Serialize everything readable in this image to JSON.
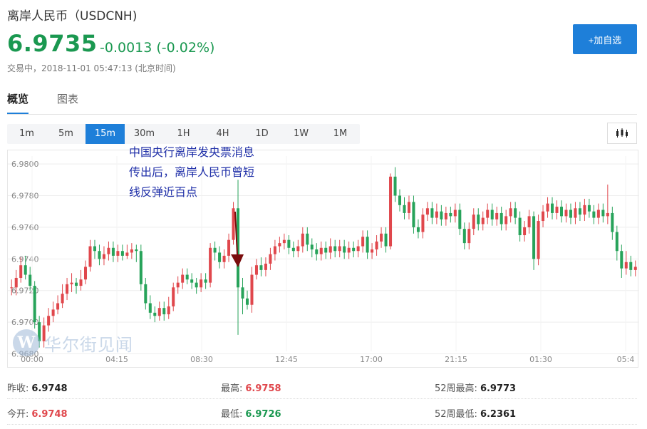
{
  "header": {
    "title": "离岸人民币（USDCNH)",
    "price": "6.9735",
    "change": "-0.0013 (-0.02%)",
    "status": "交易中，2018-11-01 05:47:13 (北京时间)",
    "add_button": "+加自选"
  },
  "tabs": [
    {
      "label": "概览",
      "active": true
    },
    {
      "label": "图表",
      "active": false
    }
  ],
  "intervals": [
    {
      "label": "1m",
      "active": false
    },
    {
      "label": "5m",
      "active": false
    },
    {
      "label": "15m",
      "active": true
    },
    {
      "label": "30m",
      "active": false
    },
    {
      "label": "1H",
      "active": false
    },
    {
      "label": "4H",
      "active": false
    },
    {
      "label": "1D",
      "active": false
    },
    {
      "label": "1W",
      "active": false
    },
    {
      "label": "1M",
      "active": false
    }
  ],
  "annotation": {
    "lines": [
      "中国央行离岸发央票消息",
      "传出后，离岸人民币曾短",
      "线反弹近百点"
    ],
    "arrow_color": "#7a0d0d"
  },
  "watermark": {
    "logo": "W",
    "text": "华尔街见闻"
  },
  "colors": {
    "up": "#e0474c",
    "down": "#27a35a",
    "accent": "#1e7fd9",
    "price": "#1a9850"
  },
  "chart_data": {
    "type": "candlestick",
    "y_ticks": [
      "6.9800",
      "6.9780",
      "6.9760",
      "6.9740",
      "6.9720",
      "6.9700",
      "6.9680"
    ],
    "ylim": [
      6.9678,
      6.9805
    ],
    "x_ticks": [
      "00:00",
      "04:15",
      "08:30",
      "12:45",
      "17:00",
      "21:15",
      "01:30",
      "05:4"
    ],
    "candles": [
      [
        6.9722,
        6.9722,
        6.9727,
        6.9717
      ],
      [
        6.9722,
        6.9728,
        6.9733,
        6.9717
      ],
      [
        6.9728,
        6.9736,
        6.9741,
        6.9725
      ],
      [
        6.9736,
        6.973,
        6.9742,
        6.9727
      ],
      [
        6.973,
        6.9723,
        6.9735,
        6.972
      ],
      [
        6.9723,
        6.97,
        6.9726,
        6.9696
      ],
      [
        6.97,
        6.9688,
        6.9704,
        6.9684
      ],
      [
        6.9688,
        6.9698,
        6.9703,
        6.9684
      ],
      [
        6.9698,
        6.9704,
        6.9709,
        6.9694
      ],
      [
        6.9704,
        6.9708,
        6.9713,
        6.97
      ],
      [
        6.9708,
        6.9712,
        6.9717,
        6.9705
      ],
      [
        6.9712,
        6.9718,
        6.9724,
        6.9709
      ],
      [
        6.9718,
        6.9724,
        6.9728,
        6.9714
      ],
      [
        6.9724,
        6.9725,
        6.9731,
        6.9719
      ],
      [
        6.9725,
        6.9723,
        6.9728,
        6.9718
      ],
      [
        6.9723,
        6.9727,
        6.9733,
        6.972
      ],
      [
        6.9727,
        6.9735,
        6.9739,
        6.9724
      ],
      [
        6.9735,
        6.9748,
        6.9752,
        6.9732
      ],
      [
        6.9748,
        6.9745,
        6.9752,
        6.974
      ],
      [
        6.9745,
        6.974,
        6.9749,
        6.9736
      ],
      [
        6.974,
        6.9743,
        6.9748,
        6.9736
      ],
      [
        6.9743,
        6.9747,
        6.9751,
        6.9739
      ],
      [
        6.9747,
        6.9742,
        6.9751,
        6.9738
      ],
      [
        6.9742,
        6.9745,
        6.9749,
        6.9738
      ],
      [
        6.9745,
        6.9742,
        6.9749,
        6.9739
      ],
      [
        6.9742,
        6.9744,
        6.9749,
        6.974
      ],
      [
        6.9744,
        6.9746,
        6.975,
        6.974
      ],
      [
        6.9746,
        6.9745,
        6.9749,
        6.9738
      ],
      [
        6.9745,
        6.9724,
        6.9749,
        6.972
      ],
      [
        6.9724,
        6.9712,
        6.9728,
        6.9708
      ],
      [
        6.9712,
        6.9706,
        6.9717,
        6.9702
      ],
      [
        6.9706,
        6.9704,
        6.971,
        6.97
      ],
      [
        6.9704,
        6.9709,
        6.9713,
        6.9701
      ],
      [
        6.9709,
        6.9705,
        6.9713,
        6.9701
      ],
      [
        6.9705,
        6.971,
        6.9716,
        6.9702
      ],
      [
        6.971,
        6.9722,
        6.9725,
        6.9707
      ],
      [
        6.9722,
        6.9725,
        6.9729,
        6.9718
      ],
      [
        6.9725,
        6.973,
        6.9734,
        6.9721
      ],
      [
        6.973,
        6.9727,
        6.9734,
        6.9724
      ],
      [
        6.9727,
        6.9725,
        6.9731,
        6.9721
      ],
      [
        6.9725,
        6.9722,
        6.9728,
        6.9718
      ],
      [
        6.9722,
        6.9727,
        6.9731,
        6.9719
      ],
      [
        6.9727,
        6.9725,
        6.9731,
        6.9721
      ],
      [
        6.9725,
        6.9747,
        6.975,
        6.9722
      ],
      [
        6.9747,
        6.9744,
        6.9751,
        6.9739
      ],
      [
        6.9744,
        6.9738,
        6.9748,
        6.9734
      ],
      [
        6.9738,
        6.9742,
        6.9746,
        6.9734
      ],
      [
        6.9742,
        6.9752,
        6.9756,
        6.9738
      ],
      [
        6.9752,
        6.9772,
        6.9776,
        6.9749
      ],
      [
        6.9772,
        6.9722,
        6.979,
        6.9692
      ],
      [
        6.9722,
        6.9715,
        6.9728,
        6.9705
      ],
      [
        6.9715,
        6.9711,
        6.972,
        6.9708
      ],
      [
        6.9711,
        6.973,
        6.9735,
        6.9706
      ],
      [
        6.973,
        6.9736,
        6.974,
        6.9727
      ],
      [
        6.9736,
        6.9733,
        6.9741,
        6.9729
      ],
      [
        6.9733,
        6.9737,
        6.9741,
        6.9729
      ],
      [
        6.9737,
        6.9743,
        6.9747,
        6.9733
      ],
      [
        6.9743,
        6.9748,
        6.9752,
        6.9739
      ],
      [
        6.9748,
        6.975,
        6.9754,
        6.9744
      ],
      [
        6.975,
        6.9752,
        6.9756,
        6.9746
      ],
      [
        6.9752,
        6.9747,
        6.9755,
        6.9743
      ],
      [
        6.9747,
        6.9745,
        6.9751,
        6.9741
      ],
      [
        6.9745,
        6.9748,
        6.9752,
        6.9741
      ],
      [
        6.9748,
        6.9756,
        6.976,
        6.9744
      ],
      [
        6.9756,
        6.9749,
        6.976,
        6.9745
      ],
      [
        6.9749,
        6.9746,
        6.9753,
        6.9741
      ],
      [
        6.9746,
        6.9743,
        6.975,
        6.9739
      ],
      [
        6.9743,
        6.9747,
        6.9751,
        6.9739
      ],
      [
        6.9747,
        6.9744,
        6.9751,
        6.974
      ],
      [
        6.9744,
        6.9748,
        6.9753,
        6.974
      ],
      [
        6.9748,
        6.9745,
        6.9752,
        6.9741
      ],
      [
        6.9745,
        6.9748,
        6.9752,
        6.9741
      ],
      [
        6.9748,
        6.9744,
        6.9752,
        6.974
      ],
      [
        6.9744,
        6.9747,
        6.9751,
        6.974
      ],
      [
        6.9747,
        6.9745,
        6.9751,
        6.9741
      ],
      [
        6.9745,
        6.9748,
        6.9752,
        6.9741
      ],
      [
        6.9748,
        6.9754,
        6.9758,
        6.9744
      ],
      [
        6.9754,
        6.9744,
        6.9758,
        6.974
      ],
      [
        6.9744,
        6.9746,
        6.975,
        6.974
      ],
      [
        6.9746,
        6.9751,
        6.9755,
        6.9742
      ],
      [
        6.9751,
        6.9756,
        6.976,
        6.9747
      ],
      [
        6.9756,
        6.9748,
        6.976,
        6.9744
      ],
      [
        6.9748,
        6.9792,
        6.9794,
        6.9746
      ],
      [
        6.9792,
        6.978,
        6.9798,
        6.9776
      ],
      [
        6.978,
        6.9774,
        6.9784,
        6.977
      ],
      [
        6.9774,
        6.9769,
        6.9779,
        6.9765
      ],
      [
        6.9769,
        6.9776,
        6.978,
        6.9765
      ],
      [
        6.9776,
        6.976,
        6.978,
        6.9756
      ],
      [
        6.976,
        6.9757,
        6.9765,
        6.9753
      ],
      [
        6.9757,
        6.9768,
        6.9772,
        6.9753
      ],
      [
        6.9768,
        6.9772,
        6.9776,
        6.9764
      ],
      [
        6.9772,
        6.9766,
        6.9776,
        6.9762
      ],
      [
        6.9766,
        6.977,
        6.9775,
        6.9762
      ],
      [
        6.977,
        6.9765,
        6.9774,
        6.9761
      ],
      [
        6.9765,
        6.9769,
        6.9773,
        6.9761
      ],
      [
        6.9769,
        6.9767,
        6.9773,
        6.9763
      ],
      [
        6.9767,
        6.9771,
        6.9775,
        6.9763
      ],
      [
        6.9771,
        6.9759,
        6.9775,
        6.9755
      ],
      [
        6.9759,
        6.975,
        6.9763,
        6.9746
      ],
      [
        6.975,
        6.9759,
        6.9763,
        6.9746
      ],
      [
        6.9759,
        6.9768,
        6.9772,
        6.9755
      ],
      [
        6.9768,
        6.9762,
        6.9772,
        6.9758
      ],
      [
        6.9762,
        6.9766,
        6.977,
        6.9758
      ],
      [
        6.9766,
        6.9771,
        6.9775,
        6.9762
      ],
      [
        6.9771,
        6.9765,
        6.9775,
        6.9761
      ],
      [
        6.9765,
        6.9769,
        6.9773,
        6.9761
      ],
      [
        6.9769,
        6.9762,
        6.9773,
        6.9758
      ],
      [
        6.9762,
        6.9767,
        6.9771,
        6.9758
      ],
      [
        6.9767,
        6.9772,
        6.9776,
        6.9763
      ],
      [
        6.9772,
        6.9766,
        6.9776,
        6.9762
      ],
      [
        6.9766,
        6.9755,
        6.977,
        6.9751
      ],
      [
        6.9755,
        6.976,
        6.9764,
        6.9751
      ],
      [
        6.976,
        6.9767,
        6.9771,
        6.9756
      ],
      [
        6.9767,
        6.974,
        6.977,
        6.9733
      ],
      [
        6.974,
        6.9764,
        6.9768,
        6.9736
      ],
      [
        6.9764,
        6.977,
        6.9774,
        6.976
      ],
      [
        6.977,
        6.9775,
        6.9779,
        6.9766
      ],
      [
        6.9775,
        6.9769,
        6.9779,
        6.9765
      ],
      [
        6.9769,
        6.9773,
        6.9777,
        6.9765
      ],
      [
        6.9773,
        6.9767,
        6.9777,
        6.9763
      ],
      [
        6.9767,
        6.9771,
        6.9775,
        6.9763
      ],
      [
        6.9771,
        6.9766,
        6.9775,
        6.9762
      ],
      [
        6.9766,
        6.9772,
        6.9776,
        6.9762
      ],
      [
        6.9772,
        6.9768,
        6.9776,
        6.9764
      ],
      [
        6.9768,
        6.9774,
        6.9778,
        6.9764
      ],
      [
        6.9774,
        6.977,
        6.9778,
        6.9766
      ],
      [
        6.977,
        6.9766,
        6.9774,
        6.9762
      ],
      [
        6.9766,
        6.9771,
        6.9775,
        6.9762
      ],
      [
        6.9771,
        6.9767,
        6.9775,
        6.9763
      ],
      [
        6.9767,
        6.9769,
        6.9787,
        6.9762
      ],
      [
        6.9769,
        6.9757,
        6.9773,
        6.9752
      ],
      [
        6.9757,
        6.9745,
        6.9761,
        6.9739
      ],
      [
        6.9745,
        6.9734,
        6.9749,
        6.9728
      ],
      [
        6.9734,
        6.9738,
        6.9745,
        6.973
      ],
      [
        6.9738,
        6.9733,
        6.9742,
        6.9729
      ],
      [
        6.9733,
        6.9735,
        6.9739,
        6.9729
      ]
    ]
  },
  "stats": {
    "rows": [
      [
        {
          "label": "昨收:",
          "value": "6.9748",
          "color": "#222"
        },
        {
          "label": "最高:",
          "value": "6.9758",
          "color": "#e0474c"
        },
        {
          "label": "52周最高:",
          "value": "6.9773",
          "color": "#222"
        }
      ],
      [
        {
          "label": "今开:",
          "value": "6.9748",
          "color": "#e0474c"
        },
        {
          "label": "最低:",
          "value": "6.9726",
          "color": "#1a9850"
        },
        {
          "label": "52周最低:",
          "value": "6.2361",
          "color": "#222"
        }
      ]
    ]
  }
}
